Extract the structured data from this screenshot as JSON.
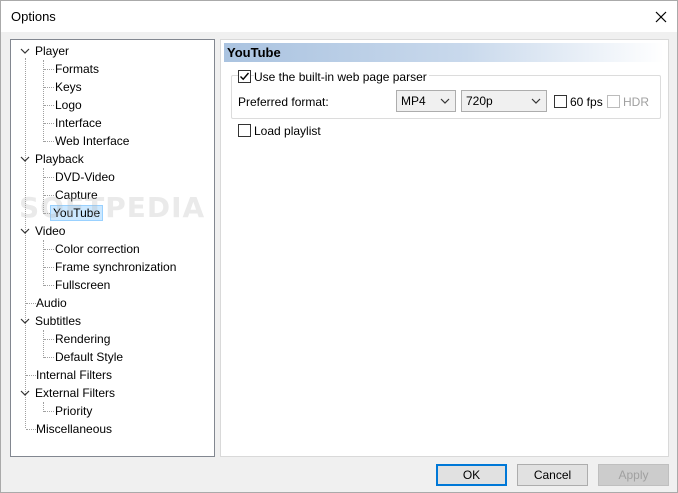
{
  "window": {
    "title": "Options"
  },
  "tree": {
    "player": "Player",
    "formats": "Formats",
    "keys": "Keys",
    "logo": "Logo",
    "interface": "Interface",
    "web_interface": "Web Interface",
    "playback": "Playback",
    "dvd_video": "DVD-Video",
    "capture": "Capture",
    "youtube": "YouTube",
    "video": "Video",
    "color_correction": "Color correction",
    "frame_sync": "Frame synchronization",
    "fullscreen": "Fullscreen",
    "audio": "Audio",
    "subtitles": "Subtitles",
    "rendering": "Rendering",
    "default_style": "Default Style",
    "internal_filters": "Internal Filters",
    "external_filters": "External Filters",
    "priority": "Priority",
    "misc": "Miscellaneous",
    "selected": "YouTube"
  },
  "panel": {
    "header": "YouTube",
    "use_parser_label": "Use the built-in web page parser",
    "use_parser_checked": true,
    "preferred_format_label": "Preferred format:",
    "format_value": "MP4",
    "resolution_value": "720p",
    "fps60_label": "60 fps",
    "fps60_checked": false,
    "hdr_label": "HDR",
    "hdr_checked": false,
    "hdr_enabled": false,
    "load_playlist_label": "Load playlist",
    "load_playlist_checked": false
  },
  "buttons": {
    "ok": "OK",
    "cancel": "Cancel",
    "apply": "Apply"
  },
  "watermark": "SOFTPEDIA",
  "colors": {
    "selection": "#cce8ff",
    "header_gradient": "#aac3e0",
    "default_button_border": "#0078d7"
  }
}
